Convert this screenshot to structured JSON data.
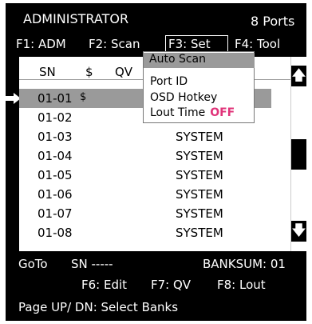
{
  "header": {
    "title": "ADMINISTRATOR",
    "ports": "8 Ports"
  },
  "fkeys": [
    {
      "label": "F1: ADM"
    },
    {
      "label": "F2: Scan"
    },
    {
      "label": "F3: Set"
    },
    {
      "label": "F4: Tool"
    }
  ],
  "table": {
    "columns": {
      "sn": "SN",
      "dollar": "$",
      "qv": "QV"
    },
    "rows": [
      {
        "sn": "01-01",
        "flag": "$",
        "name": ""
      },
      {
        "sn": "01-02",
        "flag": "",
        "name": ""
      },
      {
        "sn": "01-03",
        "flag": "",
        "name": "SYSTEM"
      },
      {
        "sn": "01-04",
        "flag": "",
        "name": "SYSTEM"
      },
      {
        "sn": "01-05",
        "flag": "",
        "name": "SYSTEM"
      },
      {
        "sn": "01-06",
        "flag": "",
        "name": "SYSTEM"
      },
      {
        "sn": "01-07",
        "flag": "",
        "name": "SYSTEM"
      },
      {
        "sn": "01-08",
        "flag": "",
        "name": "SYSTEM"
      }
    ]
  },
  "menu": {
    "items": [
      "Auto Scan",
      "Port ID",
      "OSD Hotkey",
      "Lout Time"
    ],
    "lout_value": "OFF",
    "lout_color": "#e0347a"
  },
  "scrollbar": {
    "up": "🡅",
    "down": "🡇"
  },
  "footer": {
    "goto": "GoTo",
    "sn": "SN -----",
    "banksum": "BANKSUM: 01",
    "f6": "F6:  Edit",
    "f7": "F7:  QV",
    "f8": "F8:  Lout",
    "page": "Page UP/ DN:  Select Banks"
  },
  "colors": {
    "background": "#000000",
    "panel": "#ffffff",
    "selection": "#9a9a9a"
  }
}
